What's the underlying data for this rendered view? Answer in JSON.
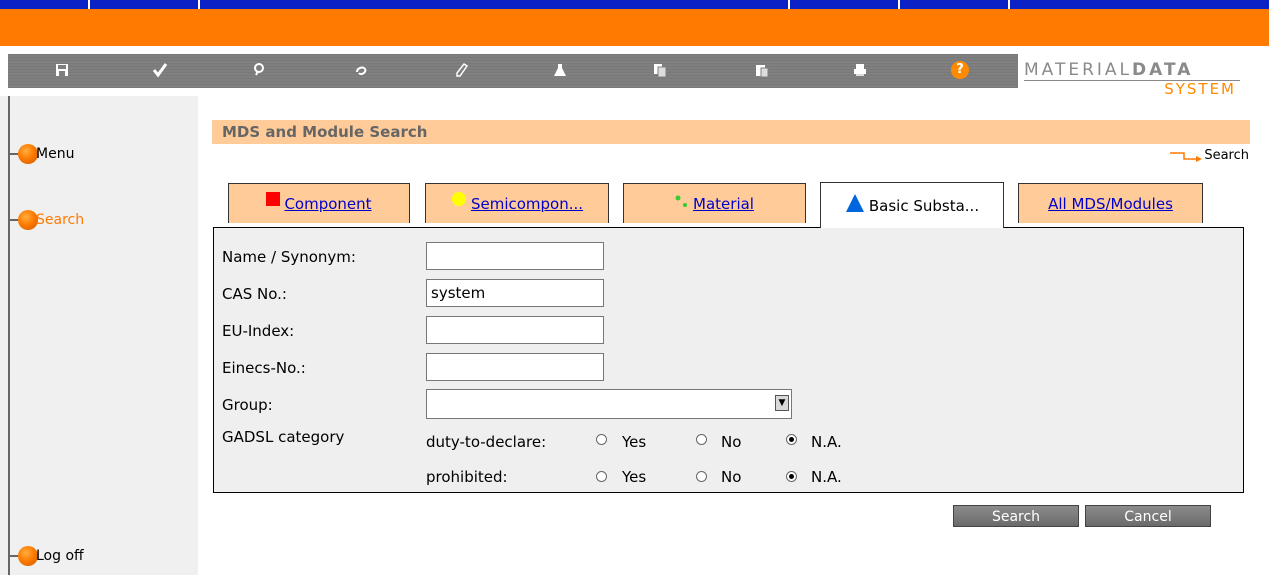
{
  "toolbar": {
    "icons": [
      "save-icon",
      "check-icon",
      "search-icon",
      "link-icon",
      "edit-icon",
      "lab-icon",
      "copy-icon",
      "paste-icon",
      "print-icon",
      "help-icon"
    ],
    "help_label": "?"
  },
  "logo": {
    "line1_light": "MATERIAL",
    "line1_bold": "DATA",
    "line2": "SYSTEM"
  },
  "nav": {
    "menu": "Menu",
    "search": "Search",
    "logoff": "Log off"
  },
  "main": {
    "section_title": "MDS and Module Search",
    "search_link": "Search",
    "tabs": [
      {
        "label": "Component",
        "marker_color": "#ff0000"
      },
      {
        "label": "Semicompon...",
        "marker_color": "#ffff00"
      },
      {
        "label": "Material",
        "marker_color": "#33cc33"
      },
      {
        "label": "Basic Substa...",
        "marker_color": "#0066cc"
      },
      {
        "label": "All MDS/Modules"
      }
    ],
    "form": {
      "name_label": "Name / Synonym:",
      "name_value": "",
      "cas_label": "CAS No.:",
      "cas_value": "system",
      "eu_label": "EU-Index:",
      "eu_value": "",
      "einecs_label": "Einecs-No.:",
      "einecs_value": "",
      "group_label": "Group:",
      "group_value": "",
      "gadsl_label": "GADSL category",
      "duty_label": "duty-to-declare:",
      "prohibited_label": "prohibited:",
      "opt_yes": "Yes",
      "opt_no": "No",
      "opt_na": "N.A.",
      "duty_selected": "N.A.",
      "prohibited_selected": "N.A."
    },
    "buttons": {
      "search": "Search",
      "cancel": "Cancel"
    }
  }
}
